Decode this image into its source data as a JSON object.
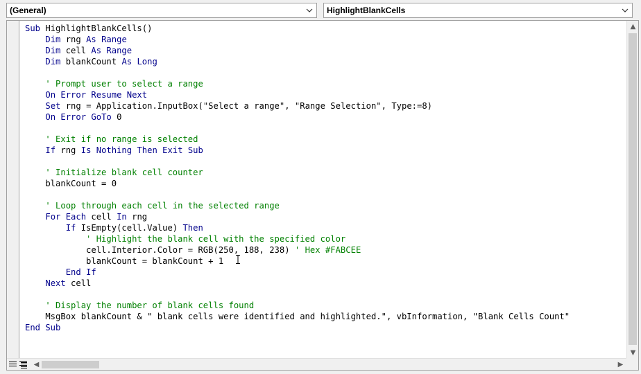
{
  "header": {
    "object_dropdown": "(General)",
    "procedure_dropdown": "HighlightBlankCells"
  },
  "code_lines": [
    [
      {
        "t": "Sub ",
        "k": "kw"
      },
      {
        "t": "HighlightBlankCells()",
        "k": ""
      }
    ],
    [
      {
        "t": "    ",
        "k": ""
      },
      {
        "t": "Dim ",
        "k": "kw"
      },
      {
        "t": "rng ",
        "k": ""
      },
      {
        "t": "As Range",
        "k": "kw"
      }
    ],
    [
      {
        "t": "    ",
        "k": ""
      },
      {
        "t": "Dim ",
        "k": "kw"
      },
      {
        "t": "cell ",
        "k": ""
      },
      {
        "t": "As Range",
        "k": "kw"
      }
    ],
    [
      {
        "t": "    ",
        "k": ""
      },
      {
        "t": "Dim ",
        "k": "kw"
      },
      {
        "t": "blankCount ",
        "k": ""
      },
      {
        "t": "As Long",
        "k": "kw"
      }
    ],
    [],
    [
      {
        "t": "    ' Prompt user to select a range",
        "k": "cm"
      }
    ],
    [
      {
        "t": "    ",
        "k": ""
      },
      {
        "t": "On Error Resume Next",
        "k": "kw"
      }
    ],
    [
      {
        "t": "    ",
        "k": ""
      },
      {
        "t": "Set ",
        "k": "kw"
      },
      {
        "t": "rng = Application.InputBox(\"Select a range\", \"Range Selection\", Type:=8)",
        "k": ""
      }
    ],
    [
      {
        "t": "    ",
        "k": ""
      },
      {
        "t": "On Error GoTo ",
        "k": "kw"
      },
      {
        "t": "0",
        "k": ""
      }
    ],
    [],
    [
      {
        "t": "    ' Exit if no range is selected",
        "k": "cm"
      }
    ],
    [
      {
        "t": "    ",
        "k": ""
      },
      {
        "t": "If ",
        "k": "kw"
      },
      {
        "t": "rng ",
        "k": ""
      },
      {
        "t": "Is Nothing Then Exit Sub",
        "k": "kw"
      }
    ],
    [],
    [
      {
        "t": "    ' Initialize blank cell counter",
        "k": "cm"
      }
    ],
    [
      {
        "t": "    blankCount = 0",
        "k": ""
      }
    ],
    [],
    [
      {
        "t": "    ' Loop through each cell in the selected range",
        "k": "cm"
      }
    ],
    [
      {
        "t": "    ",
        "k": ""
      },
      {
        "t": "For Each ",
        "k": "kw"
      },
      {
        "t": "cell ",
        "k": ""
      },
      {
        "t": "In ",
        "k": "kw"
      },
      {
        "t": "rng",
        "k": ""
      }
    ],
    [
      {
        "t": "        ",
        "k": ""
      },
      {
        "t": "If ",
        "k": "kw"
      },
      {
        "t": "IsEmpty(cell.Value) ",
        "k": ""
      },
      {
        "t": "Then",
        "k": "kw"
      }
    ],
    [
      {
        "t": "            ' Highlight the blank cell with the specified color",
        "k": "cm"
      }
    ],
    [
      {
        "t": "            cell.Interior.Color = RGB(250, 188, 238) ",
        "k": ""
      },
      {
        "t": "' Hex #FABCEE",
        "k": "cm"
      }
    ],
    [
      {
        "t": "            blankCount = blankCount + 1",
        "k": ""
      }
    ],
    [
      {
        "t": "        ",
        "k": ""
      },
      {
        "t": "End If",
        "k": "kw"
      }
    ],
    [
      {
        "t": "    ",
        "k": ""
      },
      {
        "t": "Next ",
        "k": "kw"
      },
      {
        "t": "cell",
        "k": ""
      }
    ],
    [],
    [
      {
        "t": "    ' Display the number of blank cells found",
        "k": "cm"
      }
    ],
    [
      {
        "t": "    MsgBox blankCount & \" blank cells were identified and highlighted.\", vbInformation, \"Blank Cells Count\"",
        "k": ""
      }
    ],
    [
      {
        "t": "End Sub",
        "k": "kw"
      }
    ]
  ],
  "icons": {
    "dropdown_arrow": "chevron-down-icon",
    "text_cursor": "i-beam-cursor-icon",
    "procedure_view": "procedure-view-icon",
    "full_module_view": "full-module-view-icon"
  },
  "colors": {
    "keyword": "#00008b",
    "comment": "#008000"
  }
}
